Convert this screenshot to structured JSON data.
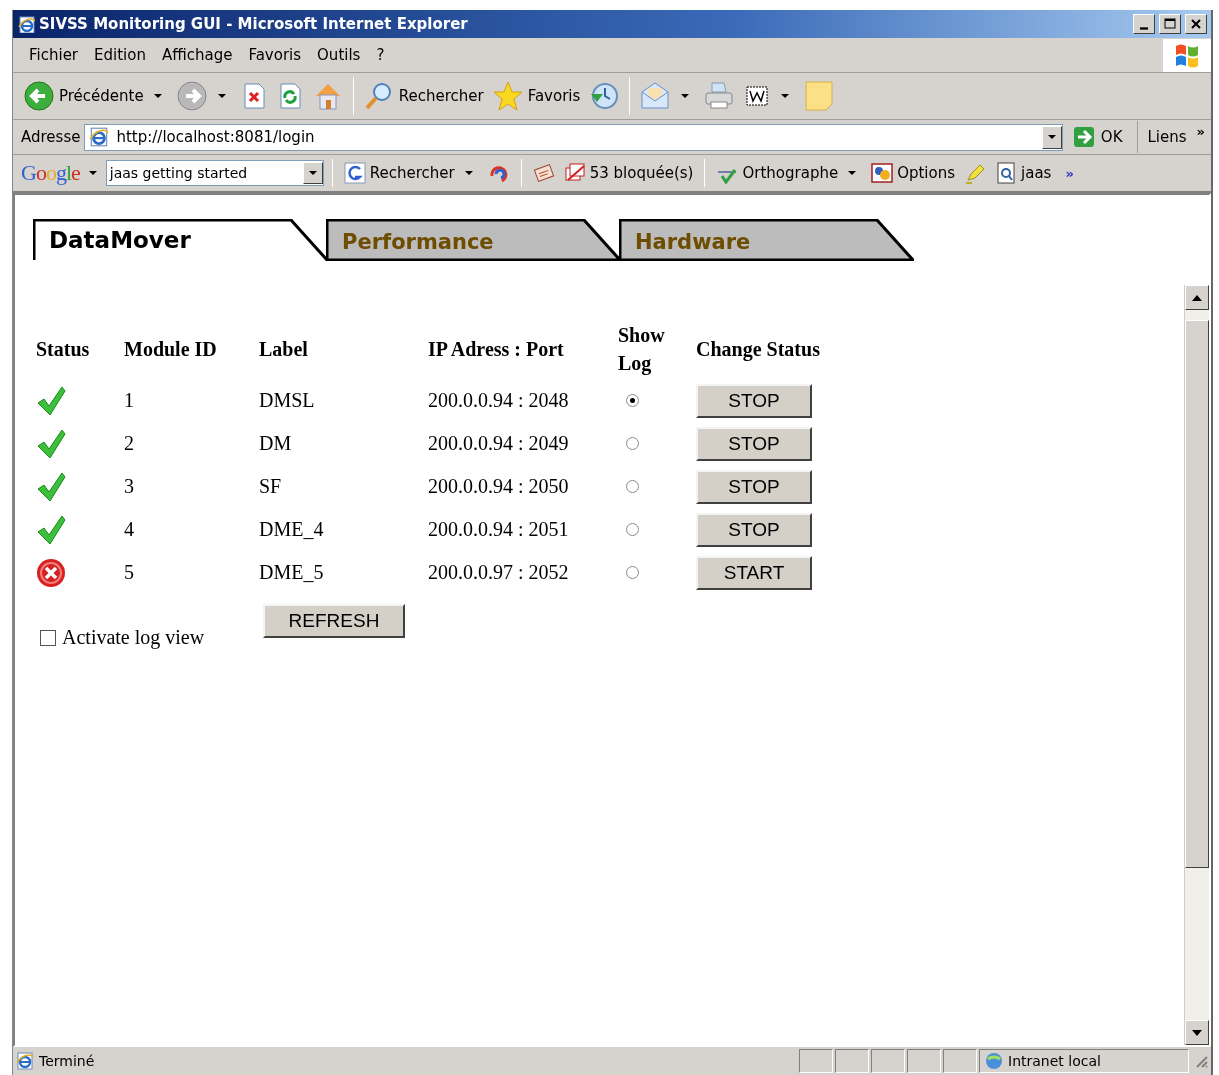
{
  "window": {
    "title": "SIVSS Monitoring GUI - Microsoft Internet Explorer"
  },
  "menu": [
    "Fichier",
    "Edition",
    "Affichage",
    "Favoris",
    "Outils",
    "?"
  ],
  "toolbar": {
    "back": "Précédente",
    "search": "Rechercher",
    "favorites": "Favoris"
  },
  "address": {
    "label": "Adresse",
    "value": "http://localhost:8081/login",
    "go": "OK",
    "links": "Liens",
    "more": "»"
  },
  "google": {
    "logo": "Google",
    "query": "jaas getting started",
    "search": "Rechercher",
    "blocked": "53 bloquée(s)",
    "spell": "Orthographe",
    "options": "Options",
    "find": "jaas",
    "more": "»"
  },
  "tabs": [
    {
      "label": "DataMover",
      "selected": true
    },
    {
      "label": "Performance",
      "selected": false
    },
    {
      "label": "Hardware",
      "selected": false
    }
  ],
  "table": {
    "columns": [
      "Status",
      "Module ID",
      "Label",
      "IP Adress : Port",
      "Show Log",
      "Change Status"
    ],
    "rows": [
      {
        "kind": "ok",
        "id": "1",
        "label": "DMSL",
        "address": "200.0.0.94 : 2048",
        "selected": true,
        "action": "STOP"
      },
      {
        "kind": "ok",
        "id": "2",
        "label": "DM",
        "address": "200.0.0.94 : 2049",
        "selected": false,
        "action": "STOP"
      },
      {
        "kind": "ok",
        "id": "3",
        "label": "SF",
        "address": "200.0.0.94 : 2050",
        "selected": false,
        "action": "STOP"
      },
      {
        "kind": "ok",
        "id": "4",
        "label": "DME_4",
        "address": "200.0.0.94 : 2051",
        "selected": false,
        "action": "STOP"
      },
      {
        "kind": "error",
        "id": "5",
        "label": "DME_5",
        "address": "200.0.0.97 : 2052",
        "selected": false,
        "action": "START"
      }
    ]
  },
  "log_view": {
    "label": "Activate log view",
    "checked": false
  },
  "refresh": "REFRESH",
  "status_bar": {
    "text": "Terminé",
    "zone": "Intranet local"
  }
}
